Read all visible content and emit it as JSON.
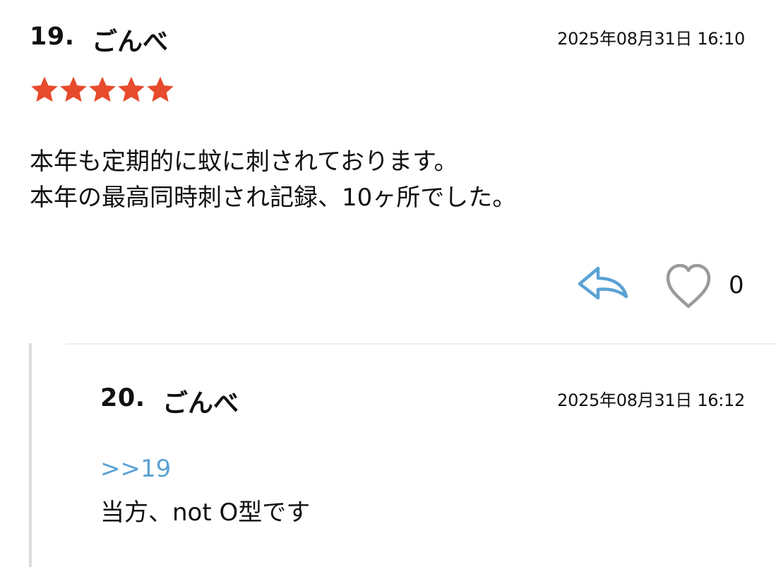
{
  "post": {
    "number": "19.",
    "author": "ごんべ",
    "date": "2025年08月31日 16:10",
    "rating": 5,
    "body_lines": [
      "本年も定期的に蚊に刺されております。",
      "本年の最高同時刺され記録、10ヶ所でした。"
    ],
    "like_count": "0"
  },
  "reply": {
    "number": "20.",
    "author": "ごんべ",
    "date": "2025年08月31日 16:12",
    "anchor": ">>19",
    "text": "当方、not O型です"
  },
  "colors": {
    "star": "#e84a2c",
    "reply_icon": "#5aa2d4",
    "heart_icon": "#9a9a9a",
    "anchor_link": "#5aa2d4"
  },
  "icons": {
    "reply": "reply-arrow-icon",
    "like": "heart-outline-icon",
    "rating": "star-icon"
  }
}
